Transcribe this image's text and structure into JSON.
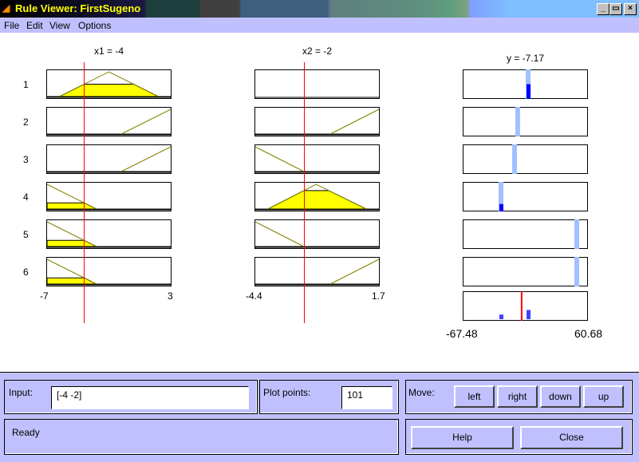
{
  "window": {
    "title": "Rule Viewer: FirstSugeno",
    "controls": [
      "_",
      "▭",
      "×"
    ]
  },
  "menu": [
    "File",
    "Edit",
    "View",
    "Options"
  ],
  "inputs": [
    {
      "label": "x1 = -4",
      "value": -4,
      "range": [
        -7,
        3
      ],
      "range_labels": [
        "-7",
        "3"
      ],
      "mfs": [
        [
          [
            -6,
            0
          ],
          [
            -2,
            1
          ],
          [
            2,
            0
          ]
        ],
        [
          [
            -1,
            0
          ],
          [
            3,
            1
          ]
        ],
        [
          [
            -1,
            0
          ],
          [
            3,
            1
          ]
        ],
        [
          [
            -7,
            1
          ],
          [
            -3,
            0
          ]
        ],
        [
          [
            -7,
            1
          ],
          [
            -3,
            0
          ]
        ],
        [
          [
            -7,
            1
          ],
          [
            -3,
            0
          ]
        ]
      ]
    },
    {
      "label": "x2 = -2",
      "value": -2,
      "range": [
        -4.4,
        1.7
      ],
      "range_labels": [
        "-4.4",
        "1.7"
      ],
      "mfs": [
        null,
        [
          [
            -0.7,
            0
          ],
          [
            1.7,
            1
          ]
        ],
        [
          [
            -4.4,
            1
          ],
          [
            -2,
            0
          ]
        ],
        [
          [
            -3.78,
            0
          ],
          [
            -1.4,
            1
          ],
          [
            1.08,
            0
          ]
        ],
        [
          [
            -4.4,
            1
          ],
          [
            -2,
            0
          ]
        ],
        [
          [
            -0.7,
            0
          ],
          [
            1.7,
            1
          ]
        ]
      ]
    }
  ],
  "rule_numbers": [
    "1",
    "2",
    "3",
    "4",
    "5",
    "6"
  ],
  "output": {
    "label": "y = -7.17",
    "value": -7.17,
    "range": [
      -67.48,
      60.68
    ],
    "range_labels": [
      "-67.48",
      "60.68"
    ],
    "rule_outputs": [
      -0.5,
      -11.2,
      -14.4,
      -28.3,
      49.3,
      49.3
    ],
    "firing": [
      0.5,
      0,
      0,
      0.25,
      0,
      0
    ]
  },
  "colors": {
    "input_line": "#ff0000",
    "mf_line": "#808000",
    "fill": "#ffff00",
    "out_light": "#a0c0ff",
    "out_dark": "#0000ff",
    "agg": "#4040ff"
  },
  "panel": {
    "input_label": "Input:",
    "input_value": "[-4 -2]",
    "plot_points_label": "Plot points:",
    "plot_points_value": "101",
    "move_label": "Move:",
    "left": "left",
    "right": "right",
    "down": "down",
    "up": "up",
    "status": "Ready",
    "help": "Help",
    "close": "Close"
  }
}
